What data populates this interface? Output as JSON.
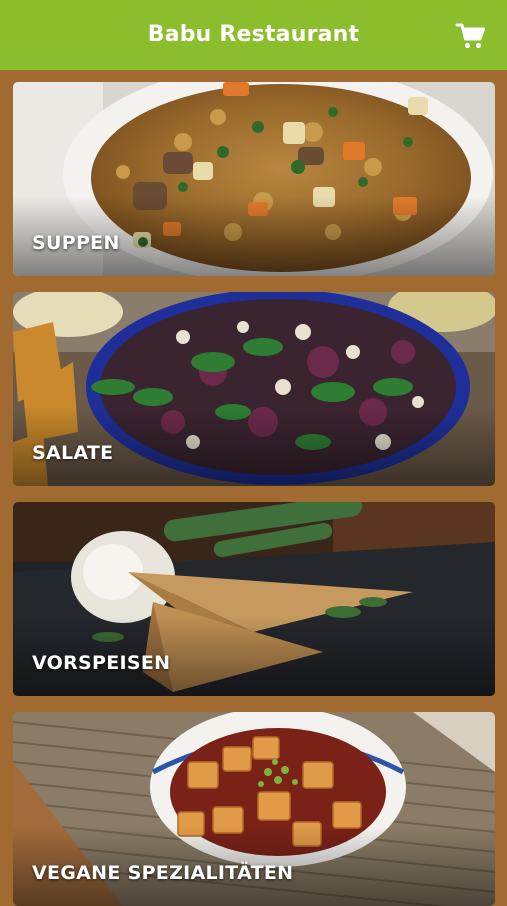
{
  "app": {
    "title": "Babu Restaurant",
    "cart_icon": "shopping-cart-icon"
  },
  "colors": {
    "header_bg": "#8cbd2c",
    "page_bg": "#a06a30",
    "label_text": "#ffffff"
  },
  "categories": [
    {
      "label": "SUPPEN",
      "image": "lentil-soup-photo"
    },
    {
      "label": "SALATE",
      "image": "salad-bowl-photo"
    },
    {
      "label": "VORSPEISEN",
      "image": "samosa-photo"
    },
    {
      "label": "VEGANE SPEZIALITÄTEN",
      "image": "tofu-curry-photo"
    }
  ]
}
